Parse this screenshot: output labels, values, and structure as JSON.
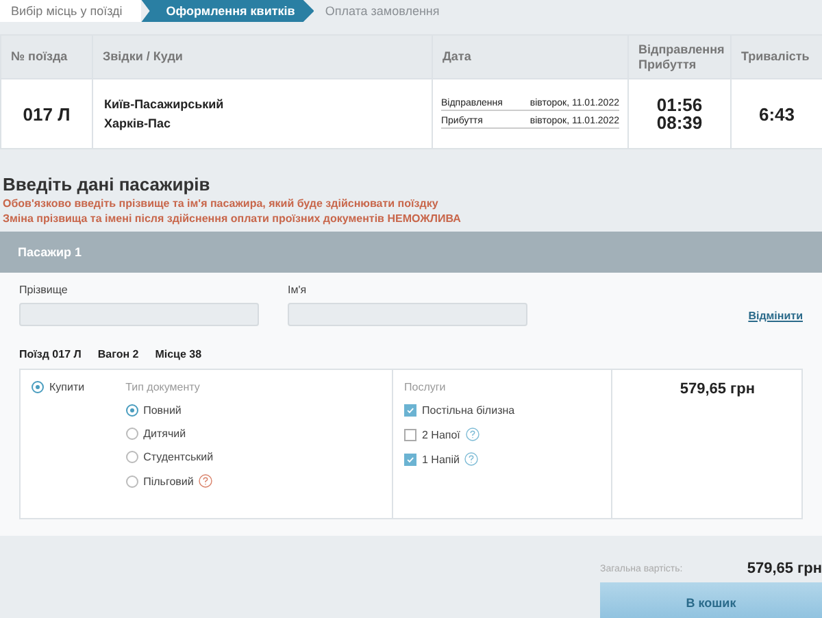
{
  "steps": [
    {
      "label": "Вибір місць у поїзді",
      "selected": false
    },
    {
      "label": "Оформлення квитків",
      "selected": true
    },
    {
      "label": "Оплата замовлення",
      "selected": false
    }
  ],
  "trip_table": {
    "columns": [
      "№ поїзда",
      "Звідки / Куди",
      "Дата",
      "Відправлення Прибуття",
      "Тривалість"
    ],
    "rows": [
      {
        "train": "017 Л",
        "from": "Київ-Пасажирський",
        "to": "Харків-Пас",
        "dates": [
          {
            "label": "Відправлення",
            "value": "вівторок, 11.01.2022"
          },
          {
            "label": "Прибуття",
            "value": "вівторок, 11.01.2022"
          }
        ],
        "departure": "01:56",
        "arrival": "08:39",
        "duration": "6:43"
      }
    ]
  },
  "heading": "Введіть дані пасажирів",
  "warnings": [
    "Обов'язково введіть прізвище та ім'я пасажира, який буде здійснювати поїздку",
    "Зміна прізвища та імені після здійснення оплати проїзних документів НЕМОЖЛИВА"
  ],
  "passenger": {
    "title": "Пасажир 1",
    "fields": [
      {
        "label": "Прізвище"
      },
      {
        "label": "Ім'я"
      }
    ],
    "cancel_link": "Відмінити",
    "seat_info": [
      "Поїзд 017 Л",
      "Вагон 2",
      "Місце 38"
    ],
    "buy": {
      "label": "Купити",
      "selected": true
    },
    "document_type": {
      "label": "Тип документу",
      "options": [
        {
          "label": "Повний",
          "selected": true,
          "help": false
        },
        {
          "label": "Дитячий",
          "selected": false,
          "help": false
        },
        {
          "label": "Студентський",
          "selected": false,
          "help": false
        },
        {
          "label": "Пільговий",
          "selected": false,
          "help": true
        }
      ]
    },
    "services": {
      "label": "Послуги",
      "items": [
        {
          "label": "Постільна білизна",
          "checked": true,
          "help": false
        },
        {
          "label": "2 Напої",
          "checked": false,
          "help": true
        },
        {
          "label": "1 Напій",
          "checked": true,
          "help": true
        }
      ]
    },
    "price": "579,65 грн"
  },
  "total": {
    "label": "Загальна вартість:",
    "value": "579,65 грн"
  },
  "cart_button": "В кошик"
}
